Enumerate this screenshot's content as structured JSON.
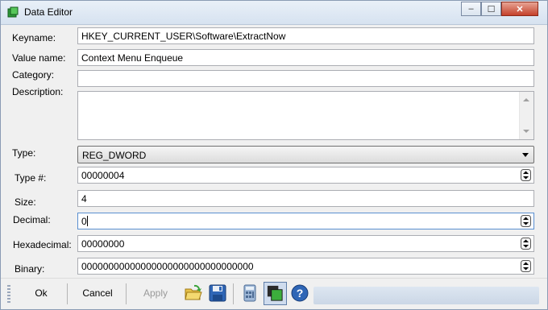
{
  "window": {
    "title": "Data Editor",
    "minimize": "–",
    "maximize": "☐",
    "close": "✕"
  },
  "colors": {
    "accent": "#2f66b6",
    "titlebar": "#dbe6f4",
    "close": "#c4412b"
  },
  "form": {
    "keyname": {
      "label": "Keyname:",
      "value": "HKEY_CURRENT_USER\\Software\\ExtractNow"
    },
    "value_name": {
      "label": "Value name:",
      "value": "Context Menu Enqueue"
    },
    "category": {
      "label": "Category:",
      "value": ""
    },
    "description": {
      "label": "Description:",
      "value": ""
    },
    "type": {
      "label": "Type:",
      "value": "REG_DWORD"
    },
    "type_num": {
      "label": "Type #:",
      "value": "00000004"
    },
    "size": {
      "label": "Size:",
      "value": "4"
    },
    "decimal": {
      "label": "Decimal:",
      "value": "0"
    },
    "hexadecimal": {
      "label": "Hexadecimal:",
      "value": "00000000"
    },
    "binary": {
      "label": "Binary:",
      "value": "00000000000000000000000000000000"
    }
  },
  "toolbar": {
    "ok_label": "Ok",
    "cancel_label": "Cancel",
    "apply_label": "Apply",
    "icons": [
      "folder-open-icon",
      "save-icon",
      "calculator-icon",
      "copy-window-icon",
      "help-icon"
    ]
  }
}
